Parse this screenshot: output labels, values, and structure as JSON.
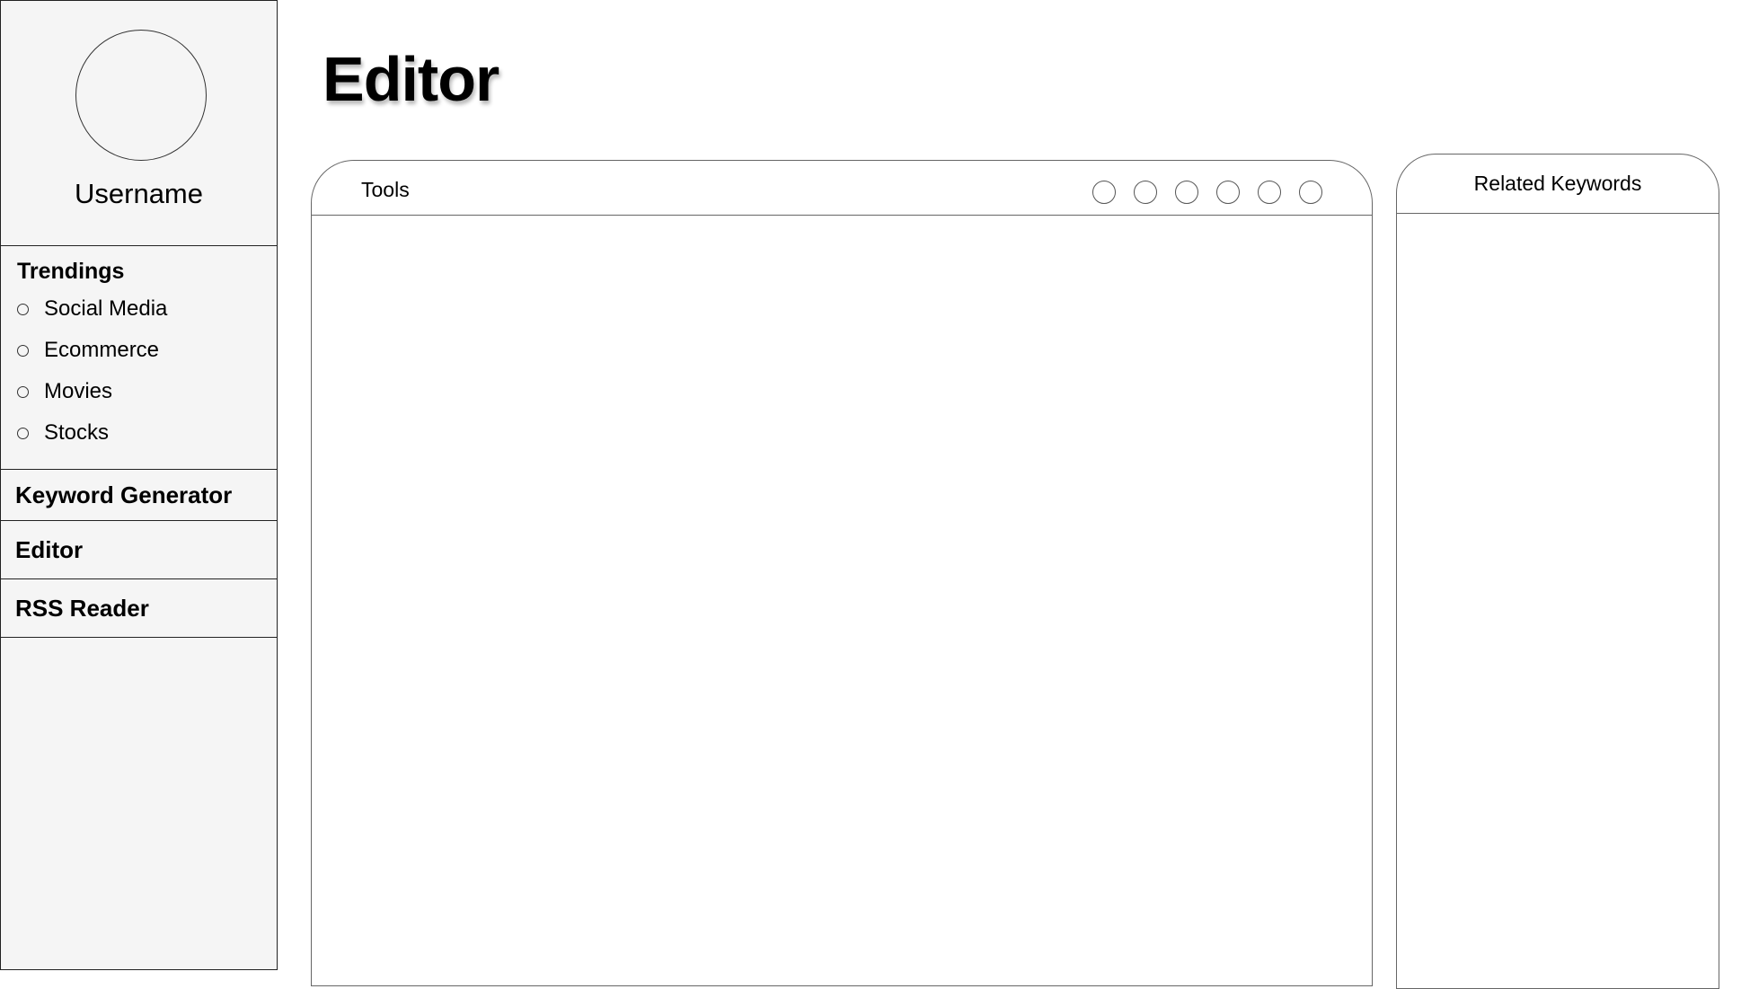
{
  "sidebar": {
    "username": "Username",
    "trendings": {
      "title": "Trendings",
      "items": [
        {
          "label": "Social Media"
        },
        {
          "label": "Ecommerce"
        },
        {
          "label": "Movies"
        },
        {
          "label": "Stocks"
        }
      ]
    },
    "nav": {
      "keyword_generator": "Keyword Generator",
      "editor": "Editor",
      "rss_reader": "RSS Reader"
    }
  },
  "main": {
    "title": "Editor",
    "editor_panel": {
      "toolbar_label": "Tools",
      "tool_button_count": 6
    },
    "keywords_panel": {
      "title": "Related Keywords"
    }
  }
}
